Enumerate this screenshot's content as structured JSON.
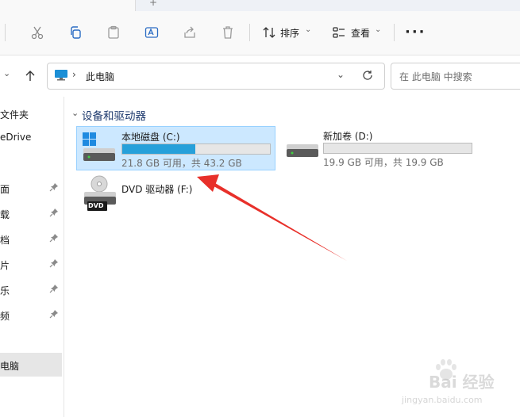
{
  "toolbar": {
    "sort_label": "排序",
    "view_label": "查看",
    "more_label": "···"
  },
  "address": {
    "path": "此电脑",
    "search_placeholder": "在 此电脑 中搜索"
  },
  "sidebar": {
    "items": [
      {
        "label": "文件夹"
      },
      {
        "label": "eDrive"
      },
      {
        "label": "面"
      },
      {
        "label": "载"
      },
      {
        "label": "档"
      },
      {
        "label": "片"
      },
      {
        "label": "乐"
      },
      {
        "label": "频"
      },
      {
        "label": "电脑"
      }
    ]
  },
  "main": {
    "group_title": "设备和驱动器",
    "drives": [
      {
        "name": "本地磁盘 (C:)",
        "info": "21.8 GB 可用，共 43.2 GB",
        "used_fraction": 0.495
      },
      {
        "name": "新加卷 (D:)",
        "info": "19.9 GB 可用，共 19.9 GB",
        "used_fraction": 0.0
      },
      {
        "name": "DVD 驱动器 (F:)",
        "badge": "DVD"
      }
    ]
  },
  "watermark": {
    "brand": "Bai 经验",
    "url": "jingyan.baidu.com"
  },
  "colors": {
    "accent": "#26a0da",
    "selection": "#cce8ff",
    "arrow": "#e8302a"
  }
}
